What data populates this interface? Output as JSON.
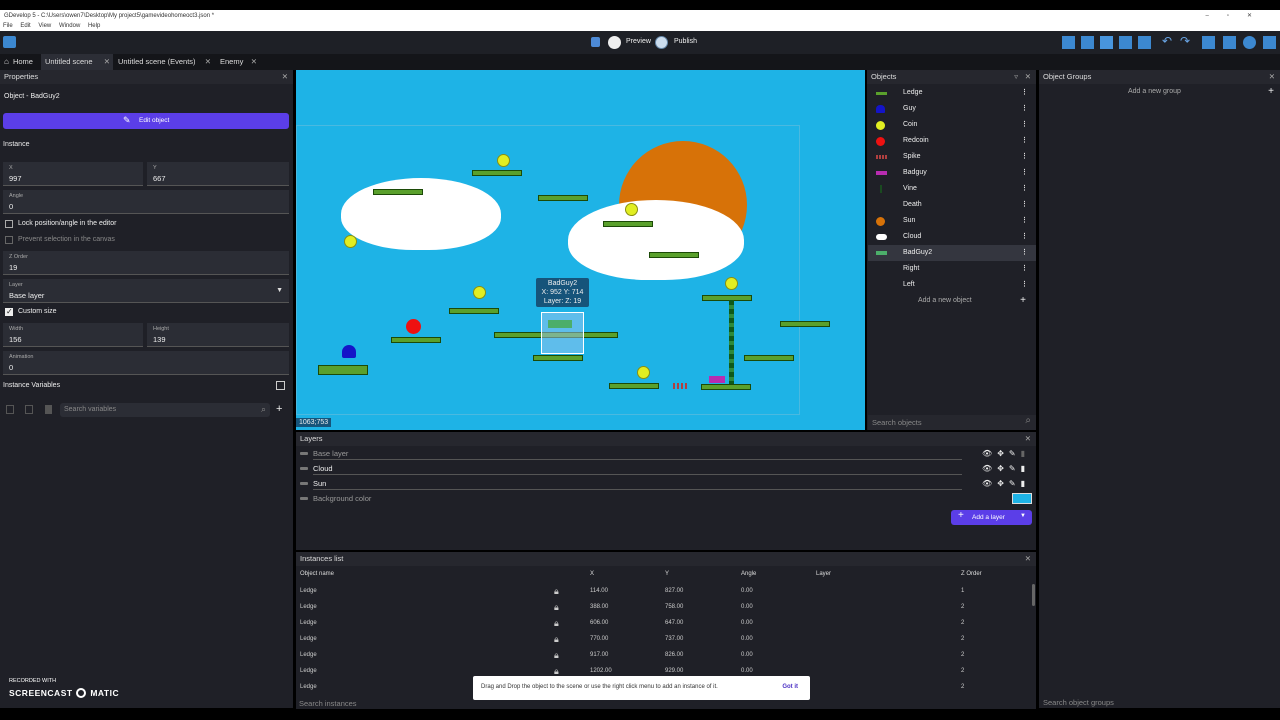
{
  "window": {
    "title": "GDevelop 5 - C:\\Users\\owen7\\Desktop\\My project5\\gamevideohomeoct3.json *",
    "menu": [
      "File",
      "Edit",
      "View",
      "Window",
      "Help"
    ]
  },
  "toolbar": {
    "preview_label": "Preview",
    "publish_label": "Publish"
  },
  "tabs": {
    "home": "Home",
    "scene": "Untitled scene",
    "events": "Untitled scene (Events)",
    "enemy": "Enemy"
  },
  "properties": {
    "title": "Properties",
    "object_line": "Object  -  BadGuy2",
    "edit_object": "Edit object",
    "instance_heading": "Instance",
    "x_label": "X",
    "x_value": "997",
    "y_label": "Y",
    "y_value": "667",
    "angle_label": "Angle",
    "angle_value": "0",
    "lock_label": "Lock position/angle in the editor",
    "prevent_label": "Prevent selection in the canvas",
    "zorder_label": "Z Order",
    "zorder_value": "19",
    "layer_label": "Layer",
    "layer_value": "Base layer",
    "custom_size_label": "Custom size",
    "width_label": "Width",
    "width_value": "156",
    "height_label": "Height",
    "height_value": "139",
    "animation_label": "Animation",
    "animation_value": "0",
    "instance_vars_title": "Instance Variables",
    "search_vars_placeholder": "Search variables"
  },
  "canvas": {
    "tooltip_name": "BadGuy2",
    "tooltip_xy": "X: 952  Y: 714",
    "tooltip_layer": "Layer:    Z: 19",
    "coords": "1063;753"
  },
  "objects": {
    "title": "Objects",
    "items": [
      {
        "name": "Ledge",
        "icon": "ledge-icon"
      },
      {
        "name": "Guy",
        "icon": "guy-icon"
      },
      {
        "name": "Coin",
        "icon": "coin-icon"
      },
      {
        "name": "Redcoin",
        "icon": "redcoin-icon"
      },
      {
        "name": "Spike",
        "icon": "spike-icon"
      },
      {
        "name": "Badguy",
        "icon": "badguy-icon"
      },
      {
        "name": "Vine",
        "icon": "vine-icon"
      },
      {
        "name": "Death",
        "icon": "death-icon"
      },
      {
        "name": "Sun",
        "icon": "sun-icon"
      },
      {
        "name": "Cloud",
        "icon": "cloud-icon"
      },
      {
        "name": "BadGuy2",
        "icon": "badguy2-icon"
      },
      {
        "name": "Right",
        "icon": "right-icon"
      },
      {
        "name": "Left",
        "icon": "left-icon"
      }
    ],
    "add_new": "Add a new object",
    "search_placeholder": "Search objects"
  },
  "groups": {
    "title": "Object Groups",
    "add_new": "Add a new group",
    "search_placeholder": "Search object groups"
  },
  "layers": {
    "title": "Layers",
    "items": [
      "Base layer",
      "Cloud",
      "Sun"
    ],
    "background_label": "Background color",
    "add_layer": "Add a layer"
  },
  "instances": {
    "title": "Instances list",
    "columns": [
      "Object name",
      "X",
      "Y",
      "Angle",
      "Layer",
      "Z Order"
    ],
    "rows": [
      [
        "Ledge",
        "114.00",
        "827.00",
        "0.00",
        "",
        "1"
      ],
      [
        "Ledge",
        "388.00",
        "758.00",
        "0.00",
        "",
        "2"
      ],
      [
        "Ledge",
        "606.00",
        "647.00",
        "0.00",
        "",
        "2"
      ],
      [
        "Ledge",
        "770.00",
        "737.00",
        "0.00",
        "",
        "2"
      ],
      [
        "Ledge",
        "917.00",
        "826.00",
        "0.00",
        "",
        "2"
      ],
      [
        "Ledge",
        "1202.00",
        "929.00",
        "0.00",
        "",
        "2"
      ],
      [
        "Ledge",
        "",
        "",
        "",
        "",
        "2"
      ]
    ],
    "search_placeholder": "Search instances"
  },
  "toast": {
    "message": "Drag and Drop the object to the scene or use the right click menu to add an instance of it.",
    "button": "Got it"
  },
  "watermark": {
    "line1": "RECORDED WITH",
    "line2": "SCREENCAST",
    "line3": "MATIC"
  }
}
